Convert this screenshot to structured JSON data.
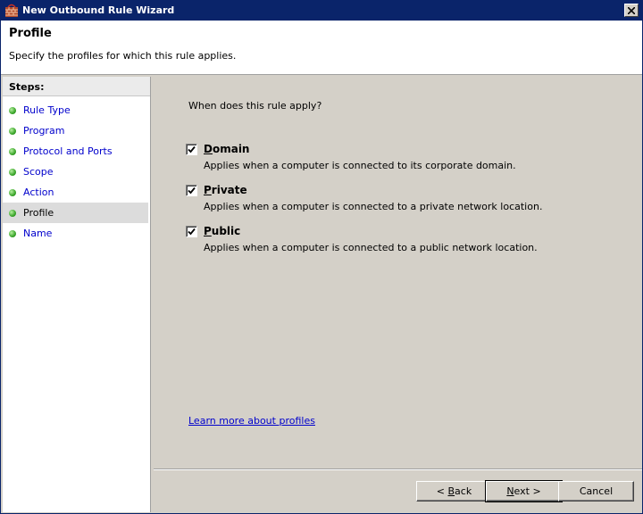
{
  "window": {
    "title": "New Outbound Rule Wizard",
    "accent_color": "#0a246a"
  },
  "header": {
    "title": "Profile",
    "subtitle": "Specify the profiles for which this rule applies."
  },
  "steps": {
    "header": "Steps:",
    "items": [
      {
        "label": "Rule Type"
      },
      {
        "label": "Program"
      },
      {
        "label": "Protocol and Ports"
      },
      {
        "label": "Scope"
      },
      {
        "label": "Action"
      },
      {
        "label": "Profile",
        "active": true
      },
      {
        "label": "Name"
      }
    ]
  },
  "main": {
    "question": "When does this rule apply?",
    "options": [
      {
        "label": "Domain",
        "checked": true,
        "description": "Applies when a computer is connected to its corporate domain."
      },
      {
        "label": "Private",
        "checked": true,
        "description": "Applies when a computer is connected to a private network location."
      },
      {
        "label": "Public",
        "checked": true,
        "description": "Applies when a computer is connected to a public network location."
      }
    ],
    "learn_more": "Learn more about profiles"
  },
  "footer": {
    "back_prefix": "< ",
    "back_key": "B",
    "back_rest": "ack",
    "next_key": "N",
    "next_rest": "ext >",
    "cancel": "Cancel"
  },
  "icons": {
    "app": "firewall-icon",
    "close": "close-icon",
    "step_bullet": "green-dot-icon",
    "check": "checkmark-icon"
  }
}
